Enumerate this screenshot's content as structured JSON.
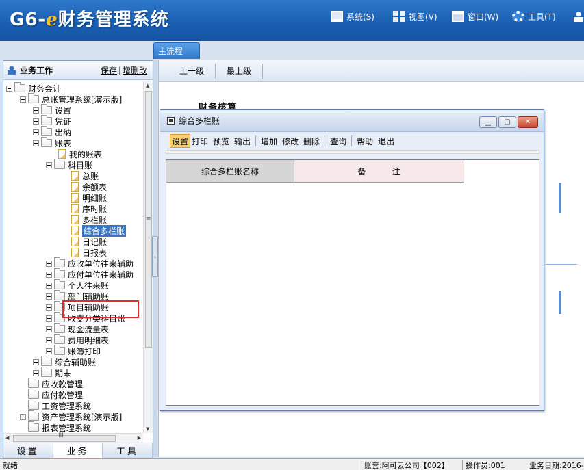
{
  "app": {
    "title_prefix": "G6-",
    "title_e": "e",
    "title_main": "财务管理系统"
  },
  "top_menu": [
    {
      "label": "系统(S)",
      "icon": "monitor-icon"
    },
    {
      "label": "视图(V)",
      "icon": "grid-icon"
    },
    {
      "label": "窗口(W)",
      "icon": "window-icon"
    },
    {
      "label": "工具(T)",
      "icon": "gear-icon"
    }
  ],
  "tabs": {
    "main": "主流程"
  },
  "left_panel": {
    "title": "业务工作",
    "save_link": "保存",
    "edit_link": "增删改",
    "bottom_tabs": [
      "设置",
      "业务",
      "工具"
    ],
    "tree": {
      "n0": "财务会计",
      "n1": "总账管理系统[演示版]",
      "n2": "设置",
      "n3": "凭证",
      "n4": "出纳",
      "n5": "账表",
      "n6": "我的账表",
      "n7": "科目账",
      "n8": "总账",
      "n9": "余额表",
      "n10": "明细账",
      "n11": "序时账",
      "n12": "多栏账",
      "n13": "综合多栏账",
      "n14": "日记账",
      "n15": "日报表",
      "n16": "应收单位往来辅助",
      "n17": "应付单位往来辅助",
      "n18": "个人往来账",
      "n19": "部门辅助账",
      "n20": "项目辅助账",
      "n21": "收支分类科目账",
      "n22": "现金流量表",
      "n23": "费用明细表",
      "n24": "账簿打印",
      "n25": "综合辅助账",
      "n26": "期末",
      "n27": "应收款管理",
      "n28": "应付款管理",
      "n29": "工资管理系统",
      "n30": "资产管理系统[演示版]",
      "n31": "报表管理系统"
    }
  },
  "main": {
    "toolbar": [
      "上一级",
      "最上级"
    ],
    "heading": "财务核算"
  },
  "dialog": {
    "title": "综合多栏账",
    "menu": [
      "设置",
      "打印",
      "预览",
      "输出",
      "增加",
      "修改",
      "删除",
      "查询",
      "帮助",
      "退出"
    ],
    "grid_headers": [
      "综合多栏账名称",
      "备          注"
    ]
  },
  "status_bar": {
    "ready": "就绪",
    "account": "账套:阿可云公司【002】",
    "operator": "操作员:001",
    "biz_date": "业务日期:2016-"
  }
}
